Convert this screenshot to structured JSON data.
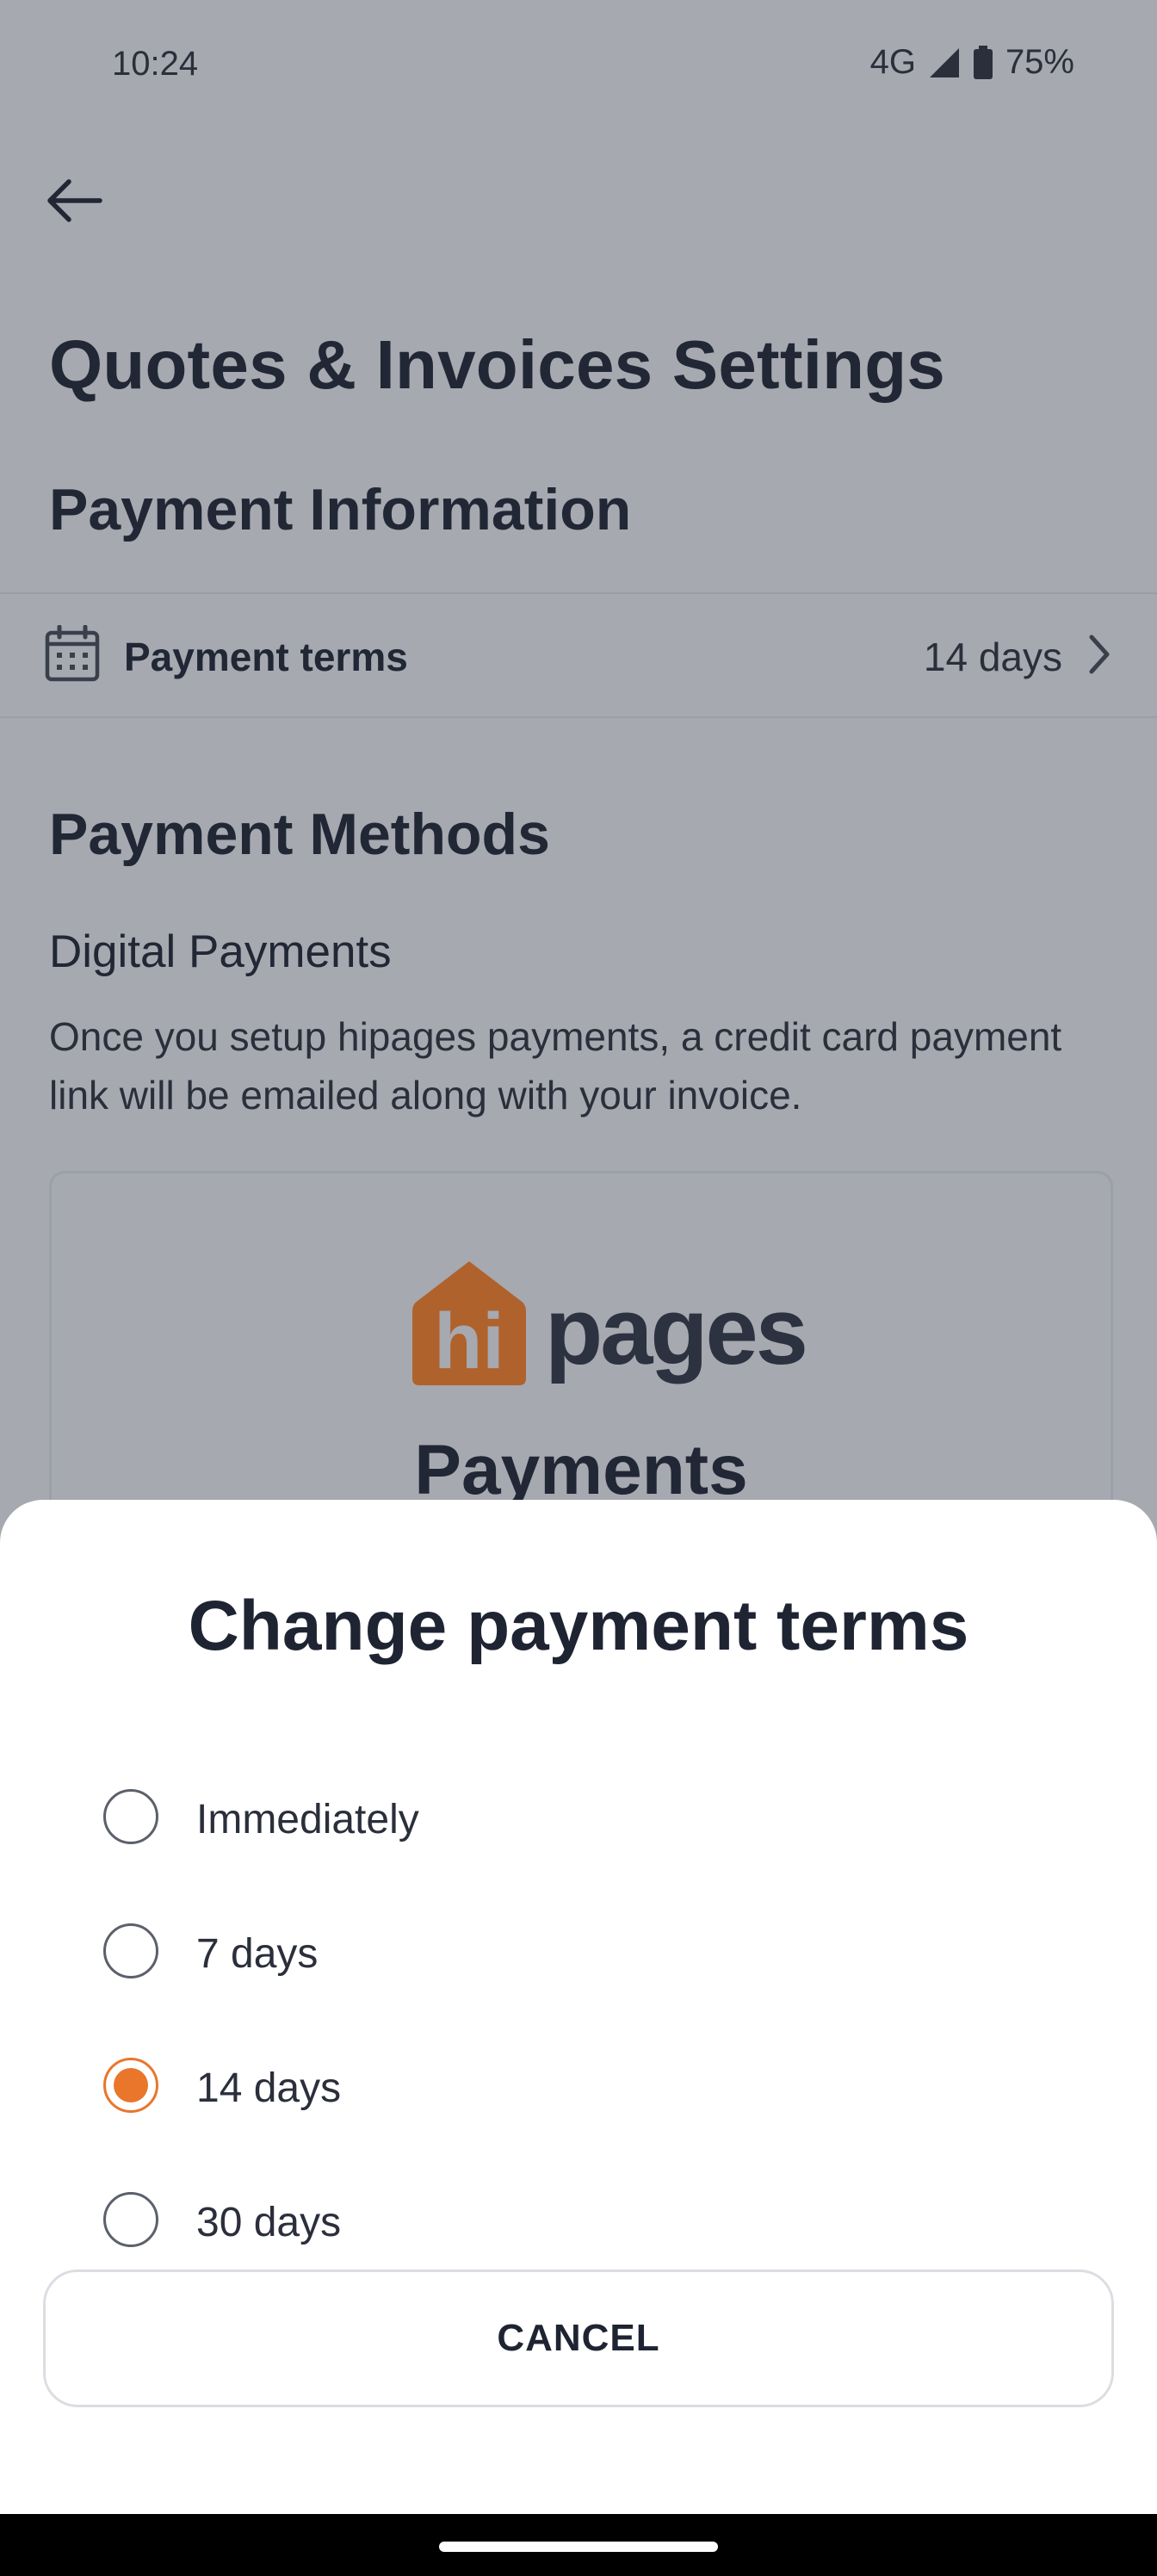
{
  "status_bar": {
    "time": "10:24",
    "network": "4G",
    "battery": "75%",
    "icons": [
      "signal-icon",
      "battery-icon"
    ]
  },
  "header": {
    "back_icon": "arrow-left-icon",
    "title": "Quotes & Invoices Settings"
  },
  "payment_information": {
    "title": "Payment Information",
    "terms_row": {
      "icon": "calendar-icon",
      "label": "Payment terms",
      "value": "14 days",
      "chevron": "chevron-right-icon"
    }
  },
  "payment_methods": {
    "title": "Payment Methods",
    "digital": {
      "title": "Digital Payments",
      "description": "Once you setup hipages payments, a credit card payment link will be emailed along with your invoice."
    },
    "card": {
      "logo_text": "hipages",
      "logo_house_text": "hi",
      "title": "Payments"
    }
  },
  "sheet": {
    "title": "Change payment terms",
    "options": [
      {
        "label": "Immediately",
        "selected": false
      },
      {
        "label": "7 days",
        "selected": false
      },
      {
        "label": "14 days",
        "selected": true
      },
      {
        "label": "30 days",
        "selected": false
      }
    ],
    "cancel_label": "CANCEL"
  },
  "colors": {
    "accent": "#e9762b",
    "scrim_background": "#a6a9b0",
    "sheet_background": "#ffffff",
    "text_primary": "#1f2433"
  }
}
